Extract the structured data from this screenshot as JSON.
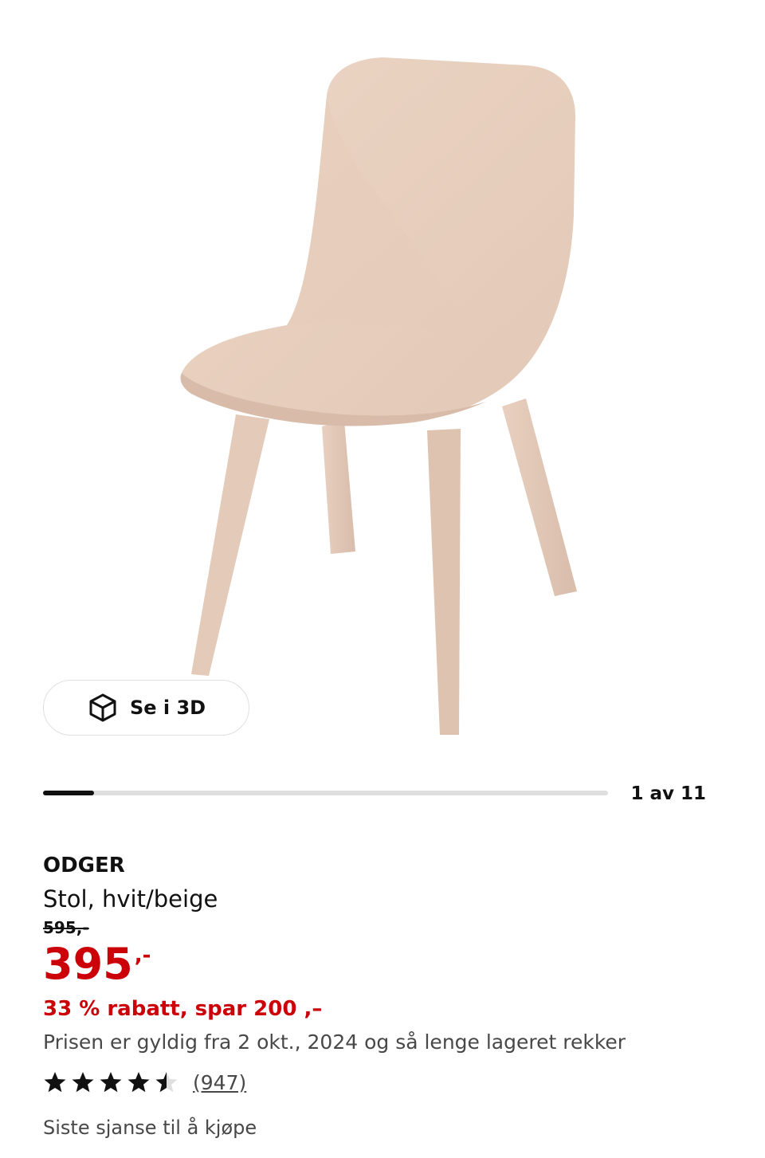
{
  "gallery": {
    "view_3d_label": "Se i 3D",
    "progress": {
      "current": 1,
      "total": 11,
      "label": "1 av 11"
    }
  },
  "product": {
    "name": "ODGER",
    "description": "Stol, hvit/beige",
    "old_price": "595,-",
    "price_integer": "395",
    "price_suffix": ",-",
    "discount_text": "33 % rabatt, spar 200 ,–",
    "validity_text": "Prisen er gyldig fra 2 okt., 2024 og så lenge lageret rekker",
    "rating": {
      "value": 4.5,
      "max": 5,
      "review_count_label": "(947)"
    },
    "availability": "Siste sjanse til å kjøpe"
  },
  "colors": {
    "price_red": "#cc0008",
    "text_dark": "#111111",
    "text_muted": "#484848",
    "chair_beige": "#e8cfbf"
  },
  "icons": {
    "view_3d": "cube-icon",
    "rating": "star-icon"
  }
}
